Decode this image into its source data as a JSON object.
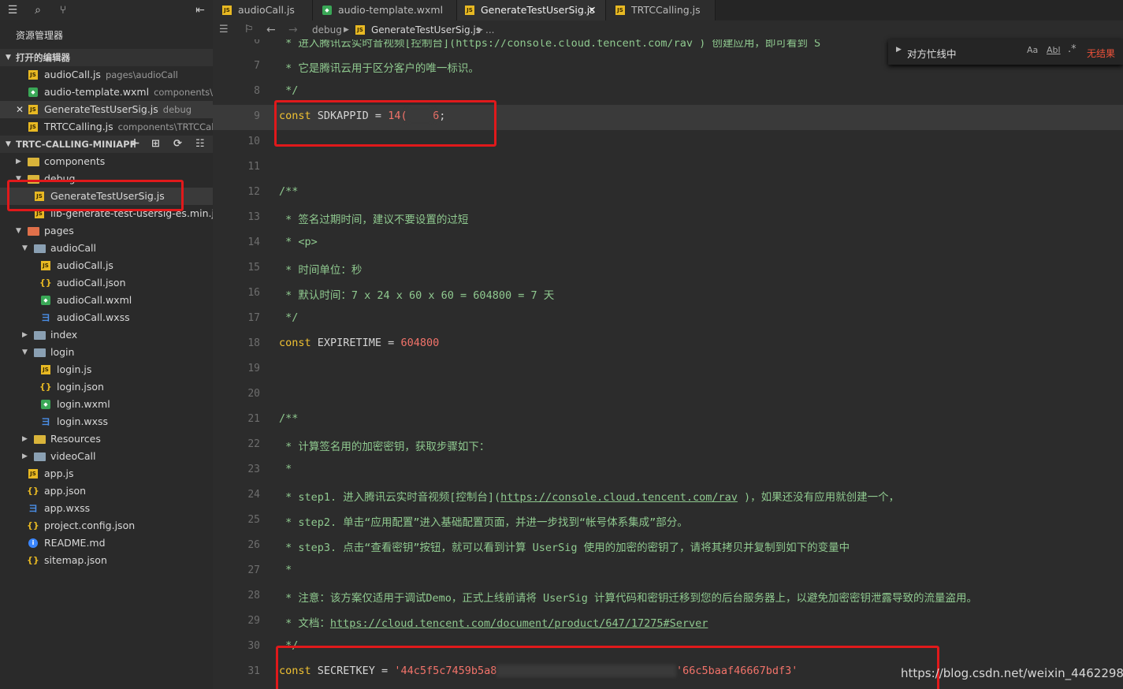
{
  "sidebar": {
    "title": "资源管理器",
    "open_editors": {
      "header": "打开的编辑器",
      "items": [
        {
          "name": "audioCall.js",
          "hint": "pages\\audioCall",
          "type": "js"
        },
        {
          "name": "audio-template.wxml",
          "hint": "components\\T...",
          "type": "wxml"
        },
        {
          "name": "GenerateTestUserSig.js",
          "hint": "debug",
          "type": "js",
          "close": "✕"
        },
        {
          "name": "TRTCCalling.js",
          "hint": "components\\TRTCCalli...",
          "type": "js"
        }
      ]
    },
    "project": {
      "header": "TRTC-CALLING-MINIAPP",
      "tree": [
        {
          "label": "components",
          "kind": "folder"
        },
        {
          "label": "debug",
          "kind": "folder"
        },
        {
          "label": "GenerateTestUserSig.js",
          "kind": "js"
        },
        {
          "label": "lib-generate-test-usersig-es.min.js",
          "kind": "js"
        },
        {
          "label": "pages",
          "kind": "folder"
        },
        {
          "label": "audioCall",
          "kind": "folder"
        },
        {
          "label": "audioCall.js",
          "kind": "js"
        },
        {
          "label": "audioCall.json",
          "kind": "json"
        },
        {
          "label": "audioCall.wxml",
          "kind": "wxml"
        },
        {
          "label": "audioCall.wxss",
          "kind": "wxss"
        },
        {
          "label": "index",
          "kind": "folder"
        },
        {
          "label": "login",
          "kind": "folder"
        },
        {
          "label": "login.js",
          "kind": "js"
        },
        {
          "label": "login.json",
          "kind": "json"
        },
        {
          "label": "login.wxml",
          "kind": "wxml"
        },
        {
          "label": "login.wxss",
          "kind": "wxss"
        },
        {
          "label": "Resources",
          "kind": "folder"
        },
        {
          "label": "videoCall",
          "kind": "folder"
        },
        {
          "label": "app.js",
          "kind": "js"
        },
        {
          "label": "app.json",
          "kind": "json"
        },
        {
          "label": "app.wxss",
          "kind": "wxss"
        },
        {
          "label": "project.config.json",
          "kind": "json"
        },
        {
          "label": "README.md",
          "kind": "md"
        },
        {
          "label": "sitemap.json",
          "kind": "json"
        }
      ]
    }
  },
  "tabs": [
    {
      "label": "audioCall.js"
    },
    {
      "label": "audio-template.wxml"
    },
    {
      "label": "GenerateTestUserSig.js",
      "close": "✕"
    },
    {
      "label": "TRTCCalling.js"
    }
  ],
  "breadcrumb": {
    "folder": "debug",
    "file": "GenerateTestUserSig.js",
    "more": "..."
  },
  "find_widget": {
    "value": "对方忙线中",
    "case": "Aa",
    "word": "Abl",
    "regex": ".*",
    "result": "无结果"
  },
  "editor": {
    "lines": [
      {
        "n": "6",
        "text": " * 进入腾讯云实时音视频[控制台](https://console.cloud.tencent.com/rav ) 创建应用，即可看到 S"
      },
      {
        "n": "7",
        "text": " * 它是腾讯云用于区分客户的唯一标识。"
      },
      {
        "n": "8",
        "text": " */"
      },
      {
        "n": "9",
        "kw": "const",
        "ident": " SDKAPPID = ",
        "val_a": "14(",
        "val_b": "6",
        "end": ";"
      },
      {
        "n": "10",
        "text": ""
      },
      {
        "n": "11",
        "text": ""
      },
      {
        "n": "12",
        "text": "/**"
      },
      {
        "n": "13",
        "text": " * 签名过期时间，建议不要设置的过短"
      },
      {
        "n": "14",
        "text": " * <p>"
      },
      {
        "n": "15",
        "text": " * 时间单位：秒"
      },
      {
        "n": "16",
        "text": " * 默认时间：7 x 24 x 60 x 60 = 604800 = 7 天"
      },
      {
        "n": "17",
        "text": " */"
      },
      {
        "n": "18",
        "kw": "const",
        "ident": " EXPIRETIME = ",
        "val": "604800"
      },
      {
        "n": "19",
        "text": ""
      },
      {
        "n": "20",
        "text": ""
      },
      {
        "n": "21",
        "text": "/**"
      },
      {
        "n": "22",
        "text": " * 计算签名用的加密密钥，获取步骤如下："
      },
      {
        "n": "23",
        "text": " *"
      },
      {
        "n": "24",
        "pre": " * step1. 进入腾讯云实时音视频[控制台](",
        "link": "https://console.cloud.tencent.com/rav",
        "post": " )，如果还没有应用就创建一个，"
      },
      {
        "n": "25",
        "text": " * step2. 单击“应用配置”进入基础配置页面，并进一步找到“帐号体系集成”部分。"
      },
      {
        "n": "26",
        "text": " * step3. 点击“查看密钥”按钮，就可以看到计算 UserSig 使用的加密的密钥了，请将其拷贝并复制到如下的变量中"
      },
      {
        "n": "27",
        "text": " *"
      },
      {
        "n": "28",
        "text": " * 注意：该方案仅适用于调试Demo，正式上线前请将 UserSig 计算代码和密钥迁移到您的后台服务器上，以避免加密密钥泄露导致的流量盗用。"
      },
      {
        "n": "29",
        "pre": " * 文档：",
        "link": "https://cloud.tencent.com/document/product/647/17275#Server",
        "post": ""
      },
      {
        "n": "30",
        "text": " */"
      },
      {
        "n": "31",
        "kw": "const",
        "ident": " SECRETKEY = ",
        "val_a": "'44c5f5c7459b5a8",
        "val_b": "'66c5baaf46667bdf3'"
      }
    ]
  },
  "watermark": "https://blog.csdn.net/weixin_44622984"
}
